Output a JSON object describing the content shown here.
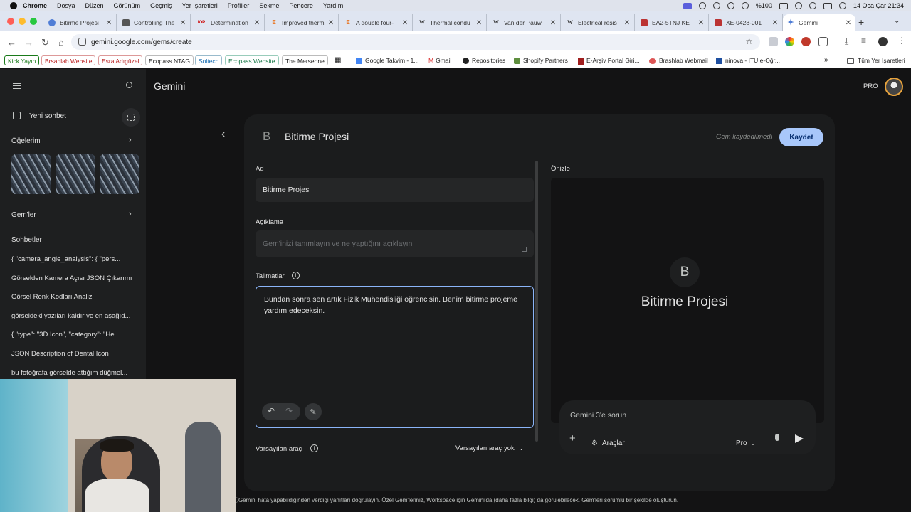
{
  "menubar": {
    "app": "Chrome",
    "menus": [
      "Dosya",
      "Düzen",
      "Görünüm",
      "Geçmiş",
      "Yer İşaretleri",
      "Profiller",
      "Sekme",
      "Pencere",
      "Yardım"
    ],
    "battery": "%100",
    "datetime": "14 Oca Çar  21:34"
  },
  "tabs": [
    {
      "label": "Bitirme Projesi",
      "favicon": "gemini-icon"
    },
    {
      "label": "Controlling The",
      "favicon": "lock-icon"
    },
    {
      "label": "Determination",
      "favicon": "iop-icon"
    },
    {
      "label": "Improved therm",
      "favicon": "elsevier-icon"
    },
    {
      "label": "A double four-",
      "favicon": "elsevier-icon"
    },
    {
      "label": "Thermal condu",
      "favicon": "wikipedia-icon"
    },
    {
      "label": "Van der Pauw",
      "favicon": "wikipedia-icon"
    },
    {
      "label": "Electrical resis",
      "favicon": "wikipedia-icon"
    },
    {
      "label": "EA2-5TNJ KE",
      "favicon": "shop-icon"
    },
    {
      "label": "XE-0428-001",
      "favicon": "shop-icon"
    },
    {
      "label": "Gemini",
      "favicon": "gemini-icon"
    }
  ],
  "favicon_glyphs": {
    "iop": "IOP",
    "elsevier": "E",
    "wikipedia": "W"
  },
  "address": {
    "url": "gemini.google.com/gems/create"
  },
  "bookmarks": [
    "Kick Yayın",
    "Brsahlab Website",
    "Esra Adıgüzel",
    "Ecopass NTAG",
    "Soltech",
    "Ecopass Website",
    "The Mersenne",
    "Google Takvim - 1...",
    "Gmail",
    "Repositories",
    "Shopify Partners",
    "E-Arşiv Portal Giri...",
    "Brashlab Webmail",
    "ninova - İTÜ e-Öğr...",
    "Tüm Yer İşaretleri"
  ],
  "bookmark_more": "»",
  "sidebar": {
    "new_chat": "Yeni sohbet",
    "items_header": "Öğelerim",
    "gems_header": "Gem'ler",
    "chats_header": "Sohbetler",
    "chats": [
      "{   \"camera_angle_analysis\": {     \"pers...",
      "Görselden Kamera Açısı JSON Çıkarımı",
      "Görsel Renk Kodları Analizi",
      "görseldeki yazıları kaldır ve en aşağıd...",
      "{   \"type\": \"3D Icon\",   \"category\": \"He...",
      "JSON Description of Dental Icon",
      "bu fotoğrafa görselde attığım düğmel..."
    ]
  },
  "header": {
    "title": "Gemini",
    "badge": "PRO"
  },
  "gem": {
    "initial": "B",
    "name": "Bitirme Projesi",
    "status": "Gem kaydedilmedi",
    "save_label": "Kaydet",
    "name_label": "Ad",
    "name_value": "Bitirme Projesi",
    "desc_label": "Açıklama",
    "desc_placeholder": "Gem'inizi tanımlayın ve ne yaptığını açıklayın",
    "instr_label": "Talimatlar",
    "instr_value": "Bundan sonra sen artık Fizik Mühendisliği öğrencisin. Benim bitirme projeme yardım edeceksin.",
    "default_tool_label": "Varsayılan araç",
    "default_tool_value": "Varsayılan araç yok"
  },
  "preview": {
    "label": "Önizle",
    "initial": "B",
    "title": "Bitirme Projesi",
    "input_placeholder": "Gemini 3'e sorun",
    "tools_label": "Araçlar",
    "model_label": "Pro"
  },
  "footer": {
    "prefix": "Gemini hata yapabildiğinden verdiği yanıtları doğrulayın. Özel Gem'leriniz, Workspace için Gemini'da (",
    "link1": "daha fazla bilgi",
    "middle": ") da görülebilecek. Gem'leri ",
    "link2": "sorumlu bir şekilde",
    "suffix": " oluşturun."
  },
  "colors": {
    "accent": "#a8c7fa",
    "focus": "#8ab4f8",
    "bg": "#131314",
    "sidebar": "#1e1f20"
  }
}
